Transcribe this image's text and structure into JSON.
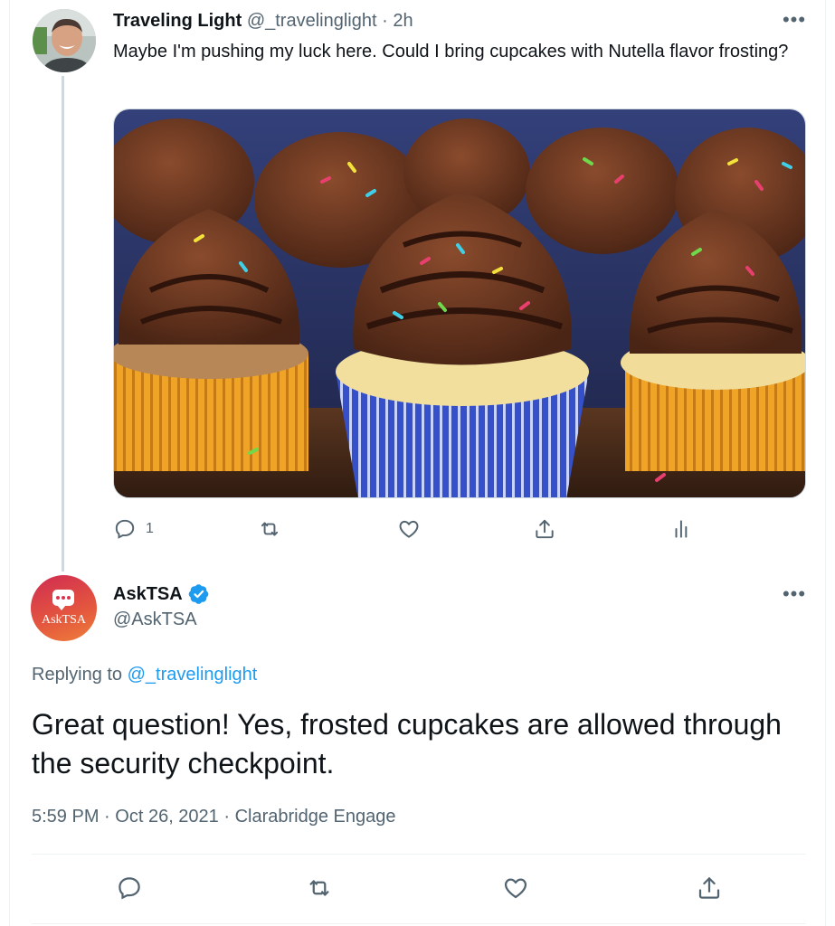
{
  "tweet1": {
    "display_name": "Traveling Light",
    "handle": "@_travelinglight",
    "separator": "·",
    "time": "2h",
    "text": "Maybe I'm pushing my luck here. Could I bring cupcakes with Nutella flavor frosting?",
    "more_icon": "more-horizontal-icon",
    "media": "photo of chocolate-frosted cupcakes with sprinkles",
    "actions": {
      "reply_count": "1",
      "reply_icon": "reply-icon",
      "retweet_icon": "retweet-icon",
      "like_icon": "heart-icon",
      "share_icon": "share-icon",
      "analytics_icon": "analytics-icon"
    }
  },
  "tweet2": {
    "display_name": "AskTSA",
    "handle": "@AskTSA",
    "avatar_text": "AskTSA",
    "verified_icon": "verified-badge-icon",
    "replying_label": "Replying to",
    "replying_to": "@_travelinglight",
    "text": "Great question! Yes, frosted cupcakes are allowed through the security checkpoint.",
    "time": "5:59 PM",
    "date": "Oct 26, 2021",
    "separator": "·",
    "source": "Clarabridge Engage",
    "more_icon": "more-horizontal-icon",
    "actions": {
      "reply_icon": "reply-icon",
      "retweet_icon": "retweet-icon",
      "like_icon": "heart-icon",
      "share_icon": "share-icon"
    }
  },
  "colors": {
    "text_primary": "#0f1419",
    "text_secondary": "#536471",
    "link": "#1d9bf0",
    "verified": "#1d9bf0",
    "divider": "#eff3f4"
  }
}
